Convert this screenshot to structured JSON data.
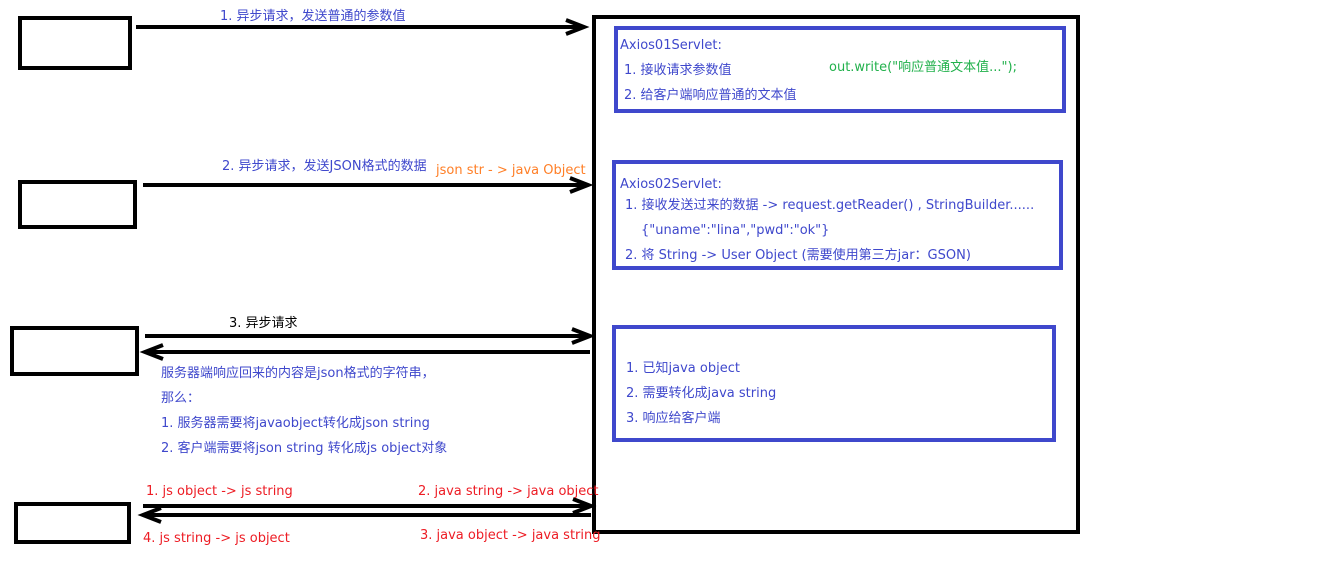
{
  "flow1": {
    "request_label": "1. 异步请求，发送普通的参数值"
  },
  "servlet1": {
    "title": "Axios01Servlet:",
    "step1": "1. 接收请求参数值",
    "step2": "2. 给客户端响应普通的文本值",
    "code": "out.write(\"响应普通文本值...\");"
  },
  "flow2": {
    "request_label": "2. 异步请求，发送JSON格式的数据",
    "conversion": "json str - > java Object"
  },
  "servlet2": {
    "title": "Axios02Servlet:",
    "step1": "1. 接收发送过来的数据 -> request.getReader() , StringBuilder......",
    "example": "{\"uname\":\"lina\",\"pwd\":\"ok\"}",
    "step2": "2. 将 String -> User Object   (需要使用第三方jar：GSON)"
  },
  "flow3": {
    "request_label": "3. 异步请求",
    "note_line1": "服务器端响应回来的内容是json格式的字符串，",
    "note_line2": "那么：",
    "note_line3": "1. 服务器需要将javaobject转化成json string",
    "note_line4": "2. 客户端需要将json string 转化成js object对象"
  },
  "servlet3": {
    "step1": "1. 已知java object",
    "step2": "2. 需要转化成java string",
    "step3": "3. 响应给客户端"
  },
  "flow4": {
    "client_step1": "1. js object -> js string",
    "server_step2": "2. java string -> java object",
    "server_step3": "3. java object -> java string",
    "client_step4": "4. js string -> js object"
  },
  "colors": {
    "blue": "#3f48cc",
    "orange": "#ff7f27",
    "green": "#22b14c",
    "red": "#ed1c24",
    "black": "#000000"
  }
}
